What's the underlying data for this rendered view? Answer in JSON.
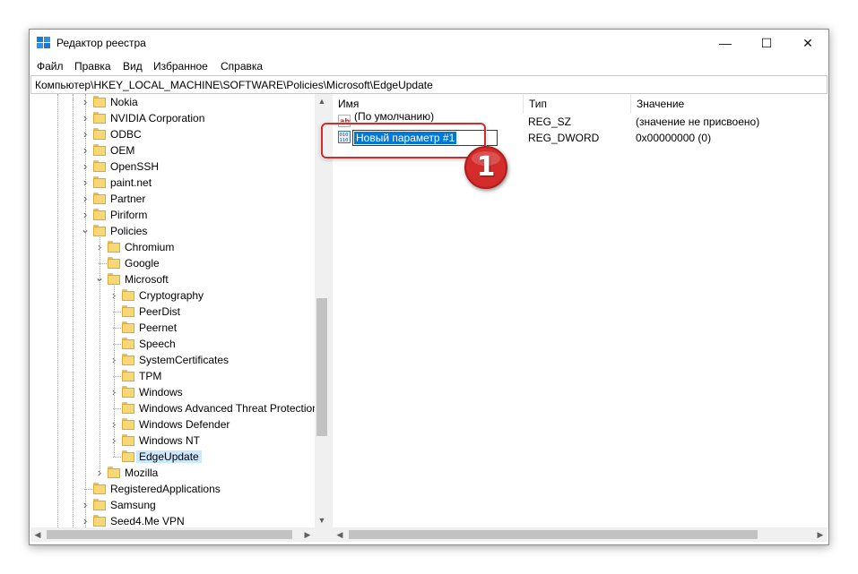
{
  "window": {
    "title": "Редактор реестра",
    "controls": {
      "minimize": "—",
      "maximize": "☐",
      "close": "✕"
    }
  },
  "menu": [
    "Файл",
    "Правка",
    "Вид",
    "Избранное",
    "Справка"
  ],
  "address": "Компьютер\\HKEY_LOCAL_MACHINE\\SOFTWARE\\Policies\\Microsoft\\EdgeUpdate",
  "tree": {
    "nodes": [
      {
        "label": "Nokia",
        "level": 0,
        "expander": "collapsed"
      },
      {
        "label": "NVIDIA Corporation",
        "level": 0,
        "expander": "collapsed"
      },
      {
        "label": "ODBC",
        "level": 0,
        "expander": "collapsed"
      },
      {
        "label": "OEM",
        "level": 0,
        "expander": "collapsed"
      },
      {
        "label": "OpenSSH",
        "level": 0,
        "expander": "collapsed"
      },
      {
        "label": "paint.net",
        "level": 0,
        "expander": "collapsed"
      },
      {
        "label": "Partner",
        "level": 0,
        "expander": "collapsed"
      },
      {
        "label": "Piriform",
        "level": 0,
        "expander": "collapsed"
      },
      {
        "label": "Policies",
        "level": 0,
        "expander": "expanded"
      },
      {
        "label": "Chromium",
        "level": 1,
        "expander": "collapsed"
      },
      {
        "label": "Google",
        "level": 1,
        "expander": "none"
      },
      {
        "label": "Microsoft",
        "level": 1,
        "expander": "expanded"
      },
      {
        "label": "Cryptography",
        "level": 2,
        "expander": "collapsed"
      },
      {
        "label": "PeerDist",
        "level": 2,
        "expander": "none"
      },
      {
        "label": "Peernet",
        "level": 2,
        "expander": "none"
      },
      {
        "label": "Speech",
        "level": 2,
        "expander": "none"
      },
      {
        "label": "SystemCertificates",
        "level": 2,
        "expander": "collapsed"
      },
      {
        "label": "TPM",
        "level": 2,
        "expander": "none"
      },
      {
        "label": "Windows",
        "level": 2,
        "expander": "collapsed"
      },
      {
        "label": "Windows Advanced Threat Protection",
        "level": 2,
        "expander": "none"
      },
      {
        "label": "Windows Defender",
        "level": 2,
        "expander": "collapsed"
      },
      {
        "label": "Windows NT",
        "level": 2,
        "expander": "collapsed"
      },
      {
        "label": "EdgeUpdate",
        "level": 2,
        "expander": "none",
        "selected": true
      },
      {
        "label": "Mozilla",
        "level": 1,
        "expander": "collapsed"
      },
      {
        "label": "RegisteredApplications",
        "level": 0,
        "expander": "none"
      },
      {
        "label": "Samsung",
        "level": 0,
        "expander": "collapsed"
      },
      {
        "label": "Seed4.Me VPN",
        "level": 0,
        "expander": "collapsed"
      }
    ]
  },
  "columns": {
    "name": "Имя",
    "type": "Тип",
    "data": "Значение"
  },
  "values": [
    {
      "name": "(По умолчанию)",
      "type": "REG_SZ",
      "data": "(значение не присвоено)",
      "icon": "string-value-icon"
    },
    {
      "name": "Новый параметр #1",
      "type": "REG_DWORD",
      "data": "0x00000000 (0)",
      "icon": "binary-value-icon",
      "editing": true
    }
  ],
  "annotation": {
    "step": "1",
    "color": "#d42b2b"
  },
  "colors": {
    "selection": "#0078d7",
    "folder": "#f8d775",
    "tree_selected": "#cce8ff"
  }
}
